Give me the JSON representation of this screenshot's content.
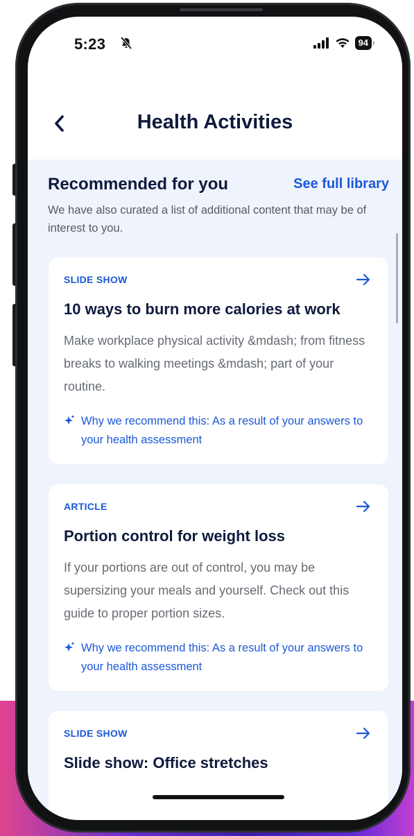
{
  "status_bar": {
    "time": "5:23",
    "battery": "94"
  },
  "header": {
    "title": "Health Activities"
  },
  "section": {
    "title": "Recommended for you",
    "link": "See full library",
    "description": "We have also curated a list of additional content that may be of interest to you."
  },
  "cards": [
    {
      "type": "SLIDE SHOW",
      "title": "10 ways to burn more calories at work",
      "description": "Make workplace physical activity &mdash; from fitness breaks to walking meetings &mdash; part of your routine.",
      "why": "Why we recommend this: As a result of your answers to your health assessment"
    },
    {
      "type": "ARTICLE",
      "title": "Portion control for weight loss",
      "description": "If your portions are out of control, you may be supersizing your meals and yourself. Check out this guide to proper portion sizes.",
      "why": "Why we recommend this: As a result of your answers to your health assessment"
    },
    {
      "type": "SLIDE SHOW",
      "title": "Slide show: Office stretches"
    }
  ],
  "colors": {
    "accent": "#1b58d8",
    "title_text": "#0f1a3d",
    "content_bg": "#eef3fc"
  },
  "icons": [
    "bell-slash-icon",
    "signal-icon",
    "wifi-icon",
    "battery-icon",
    "back-chevron-icon",
    "arrow-right-icon",
    "sparkle-icon"
  ]
}
